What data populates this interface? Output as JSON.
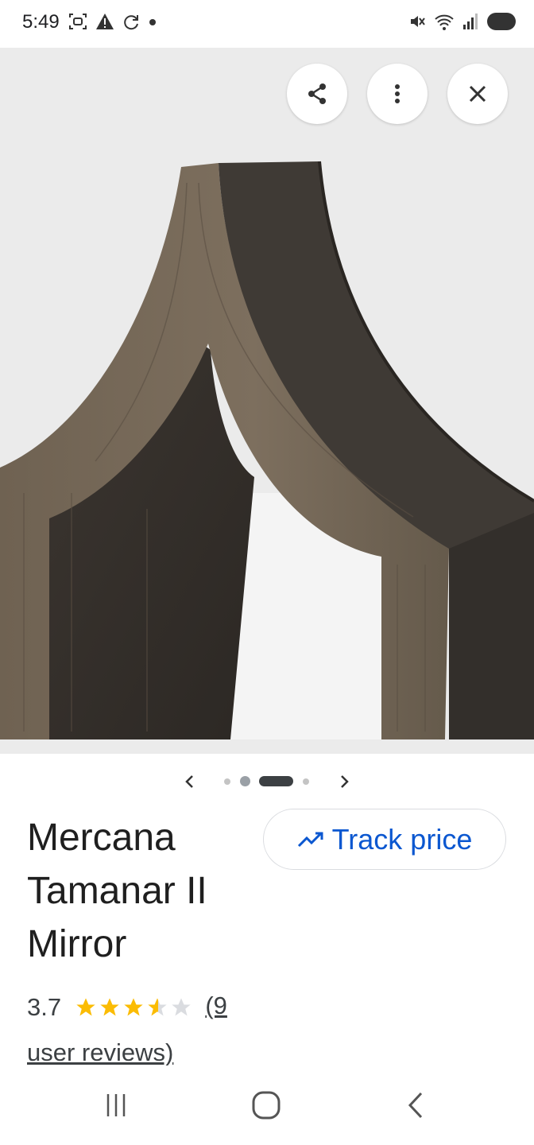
{
  "status_bar": {
    "time": "5:49",
    "left_icons": [
      "screenshot-icon",
      "warning-icon",
      "sync-icon",
      "dot-icon"
    ],
    "right_icons": [
      "mute-icon",
      "wifi-icon",
      "signal-icon",
      "battery-icon"
    ]
  },
  "gallery": {
    "image_subject": "wooden arched mirror frame",
    "buttons": [
      "share-icon",
      "more-vert-icon",
      "close-icon"
    ],
    "carousel": {
      "total_images": 4,
      "active_index": 2
    }
  },
  "product": {
    "title": "Mercana Tamanar II Mirror",
    "track_price_label": "Track price",
    "rating_value": "3.7",
    "rating_stars": 3.7,
    "review_link_text": "(9 user reviews)"
  },
  "colors": {
    "accent": "#0b57d0",
    "star": "#fbbc04",
    "star_empty": "#dadce0"
  },
  "nav_bar": {
    "buttons": [
      "recents-icon",
      "home-icon",
      "back-icon"
    ]
  }
}
